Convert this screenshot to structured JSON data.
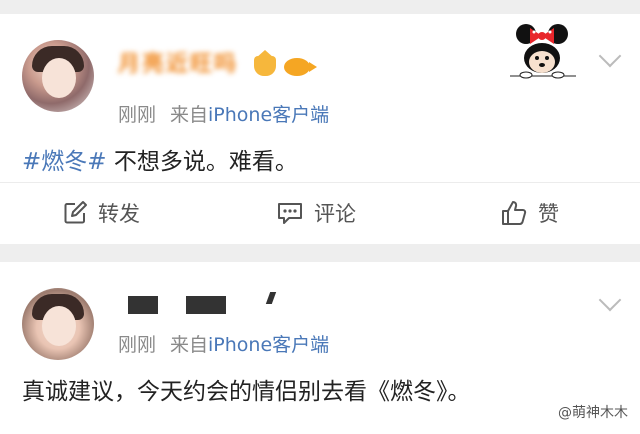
{
  "posts": [
    {
      "username": "月亮近旺吗",
      "time": "刚刚",
      "source_prefix": "来自",
      "source_app": "iPhone客户端",
      "hashtag": "#燃冬#",
      "text": " 不想多说。难看。",
      "actions": {
        "repost": "转发",
        "comment": "评论",
        "like": "赞"
      }
    },
    {
      "time": "刚刚",
      "source_prefix": "来自",
      "source_app": "iPhone客户端",
      "text": "真诚建议，今天约会的情侣别去看《燃冬》。"
    }
  ],
  "watermark": "@萌神木木",
  "icons": {
    "repost": "edit-square-icon",
    "comment": "comment-bubble-icon",
    "like": "thumbs-up-icon",
    "menu": "chevron-down-icon"
  },
  "colors": {
    "link": "#4a78b8",
    "username": "#f08a24",
    "meta": "#8a8a8a"
  }
}
